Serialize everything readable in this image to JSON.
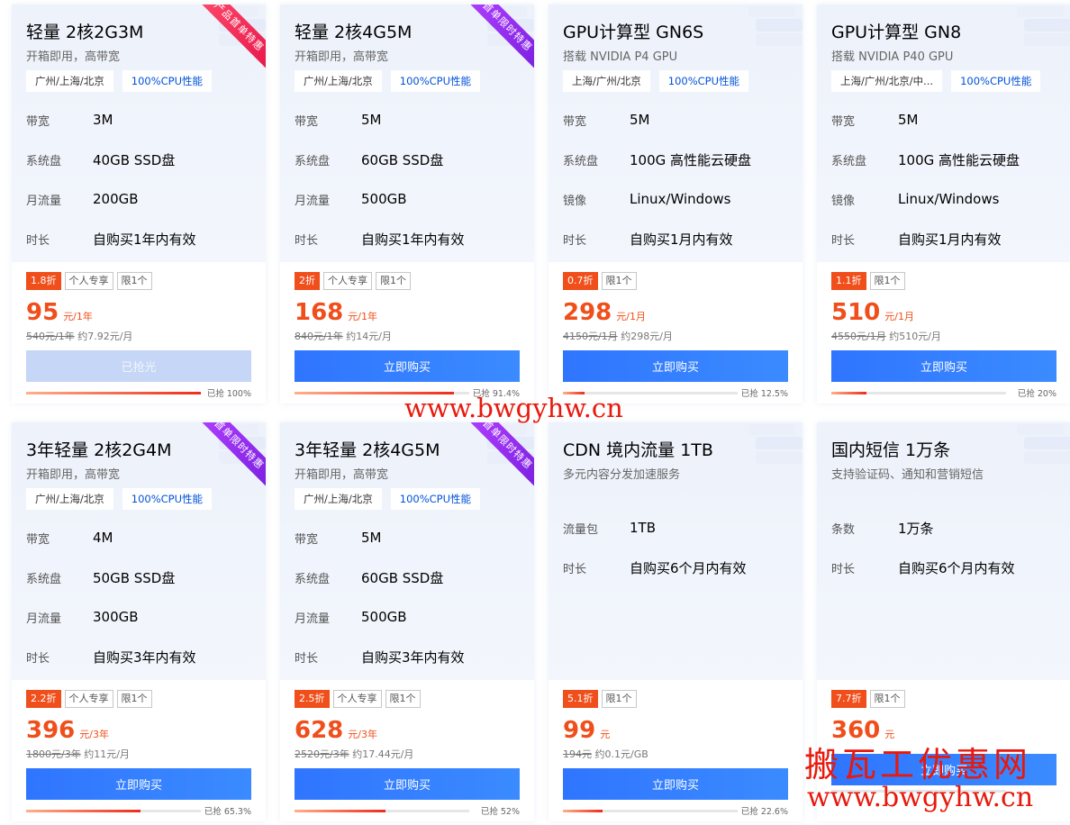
{
  "cards": [
    {
      "title": "轻量 2核2G3M",
      "subtitle": "开箱即用，高带宽",
      "ribbon": "产品首单特惠",
      "ribbon_color": "red",
      "tags": [
        "广州/上海/北京",
        "100%CPU性能"
      ],
      "specs": [
        {
          "k": "带宽",
          "v": "3M"
        },
        {
          "k": "系统盘",
          "v": "40GB SSD盘"
        },
        {
          "k": "月流量",
          "v": "200GB"
        },
        {
          "k": "时长",
          "v": "自购买1年内有效"
        }
      ],
      "badges": [
        "1.8折",
        "个人专享",
        "限1个"
      ],
      "price": "95",
      "unit": "元/1年",
      "orig_strike": "540元/1年",
      "orig_rest": "约7.92元/月",
      "button": "已抢光",
      "button_disabled": true,
      "progress_text": "已抢 100%",
      "progress": 1.0
    },
    {
      "title": "轻量 2核4G5M",
      "subtitle": "开箱即用，高带宽",
      "ribbon": "首单限时特惠",
      "ribbon_color": "purple",
      "tags": [
        "广州/上海/北京",
        "100%CPU性能"
      ],
      "specs": [
        {
          "k": "带宽",
          "v": "5M"
        },
        {
          "k": "系统盘",
          "v": "60GB SSD盘"
        },
        {
          "k": "月流量",
          "v": "500GB"
        },
        {
          "k": "时长",
          "v": "自购买1年内有效"
        }
      ],
      "badges": [
        "2折",
        "个人专享",
        "限1个"
      ],
      "price": "168",
      "unit": "元/1年",
      "orig_strike": "840元/1年",
      "orig_rest": "约14元/月",
      "button": "立即购买",
      "button_disabled": false,
      "progress_text": "已抢 91.4%",
      "progress": 0.914
    },
    {
      "title": "GPU计算型 GN6S",
      "subtitle": "搭载 NVIDIA P4 GPU",
      "ribbon": "",
      "ribbon_color": "",
      "tags": [
        "上海/广州/北京",
        "100%CPU性能"
      ],
      "specs": [
        {
          "k": "带宽",
          "v": "5M"
        },
        {
          "k": "系统盘",
          "v": "100G 高性能云硬盘"
        },
        {
          "k": "镜像",
          "v": "Linux/Windows"
        },
        {
          "k": "时长",
          "v": "自购买1月内有效"
        }
      ],
      "badges": [
        "0.7折",
        "限1个"
      ],
      "price": "298",
      "unit": "元/1月",
      "orig_strike": "4150元/1月",
      "orig_rest": "约298元/月",
      "button": "立即购买",
      "button_disabled": false,
      "progress_text": "已抢 12.5%",
      "progress": 0.125
    },
    {
      "title": "GPU计算型 GN8",
      "subtitle": "搭载 NVIDIA P40 GPU",
      "ribbon": "",
      "ribbon_color": "",
      "tags": [
        "上海/广州/北京/中...",
        "100%CPU性能"
      ],
      "specs": [
        {
          "k": "带宽",
          "v": "5M"
        },
        {
          "k": "系统盘",
          "v": "100G 高性能云硬盘"
        },
        {
          "k": "镜像",
          "v": "Linux/Windows"
        },
        {
          "k": "时长",
          "v": "自购买1月内有效"
        }
      ],
      "badges": [
        "1.1折",
        "限1个"
      ],
      "price": "510",
      "unit": "元/1月",
      "orig_strike": "4550元/1月",
      "orig_rest": "约510元/月",
      "button": "立即购买",
      "button_disabled": false,
      "progress_text": "已抢 20%",
      "progress": 0.2
    },
    {
      "title": "3年轻量 2核2G4M",
      "subtitle": "开箱即用，高带宽",
      "ribbon": "首单限时特惠",
      "ribbon_color": "purple",
      "tags": [
        "广州/上海/北京",
        "100%CPU性能"
      ],
      "specs": [
        {
          "k": "带宽",
          "v": "4M"
        },
        {
          "k": "系统盘",
          "v": "50GB SSD盘"
        },
        {
          "k": "月流量",
          "v": "300GB"
        },
        {
          "k": "时长",
          "v": "自购买3年内有效"
        }
      ],
      "badges": [
        "2.2折",
        "个人专享",
        "限1个"
      ],
      "price": "396",
      "unit": "元/3年",
      "orig_strike": "1800元/3年",
      "orig_rest": "约11元/月",
      "button": "立即购买",
      "button_disabled": false,
      "progress_text": "已抢 65.3%",
      "progress": 0.653
    },
    {
      "title": "3年轻量 2核4G5M",
      "subtitle": "开箱即用，高带宽",
      "ribbon": "首单限时特惠",
      "ribbon_color": "purple",
      "tags": [
        "广州/上海/北京",
        "100%CPU性能"
      ],
      "specs": [
        {
          "k": "带宽",
          "v": "5M"
        },
        {
          "k": "系统盘",
          "v": "60GB SSD盘"
        },
        {
          "k": "月流量",
          "v": "500GB"
        },
        {
          "k": "时长",
          "v": "自购买3年内有效"
        }
      ],
      "badges": [
        "2.5折",
        "个人专享",
        "限1个"
      ],
      "price": "628",
      "unit": "元/3年",
      "orig_strike": "2520元/3年",
      "orig_rest": "约17.44元/月",
      "button": "立即购买",
      "button_disabled": false,
      "progress_text": "已抢 52%",
      "progress": 0.52
    },
    {
      "title": "CDN 境内流量 1TB",
      "subtitle": "多元内容分发加速服务",
      "ribbon": "",
      "ribbon_color": "",
      "tags": [],
      "specs": [
        {
          "k": "流量包",
          "v": "1TB"
        },
        {
          "k": "时长",
          "v": "自购买6个月内有效"
        }
      ],
      "badges": [
        "5.1折",
        "限1个"
      ],
      "price": "99",
      "unit": "元",
      "orig_strike": "194元",
      "orig_rest": "约0.1元/GB",
      "button": "立即购买",
      "button_disabled": false,
      "progress_text": "已抢 22.6%",
      "progress": 0.226
    },
    {
      "title": "国内短信 1万条",
      "subtitle": "支持验证码、通知和营销短信",
      "ribbon": "",
      "ribbon_color": "",
      "tags": [],
      "specs": [
        {
          "k": "条数",
          "v": "1万条"
        },
        {
          "k": "时长",
          "v": "自购买6个月内有效"
        }
      ],
      "badges": [
        "7.7折",
        "限1个"
      ],
      "price": "360",
      "unit": "元",
      "orig_strike": "",
      "orig_rest": "",
      "button": "立即购买",
      "button_disabled": false,
      "progress_text": "",
      "progress": 0
    }
  ],
  "watermarks": {
    "center": "www.bwgyhw.cn",
    "corner_cn": "搬瓦工优惠网",
    "corner_url": "www.bwgyhw.cn"
  },
  "colors": {
    "accent_orange": "#f04e1a",
    "button_blue": "#2f75ff",
    "watermark_red": "#e8180c"
  }
}
